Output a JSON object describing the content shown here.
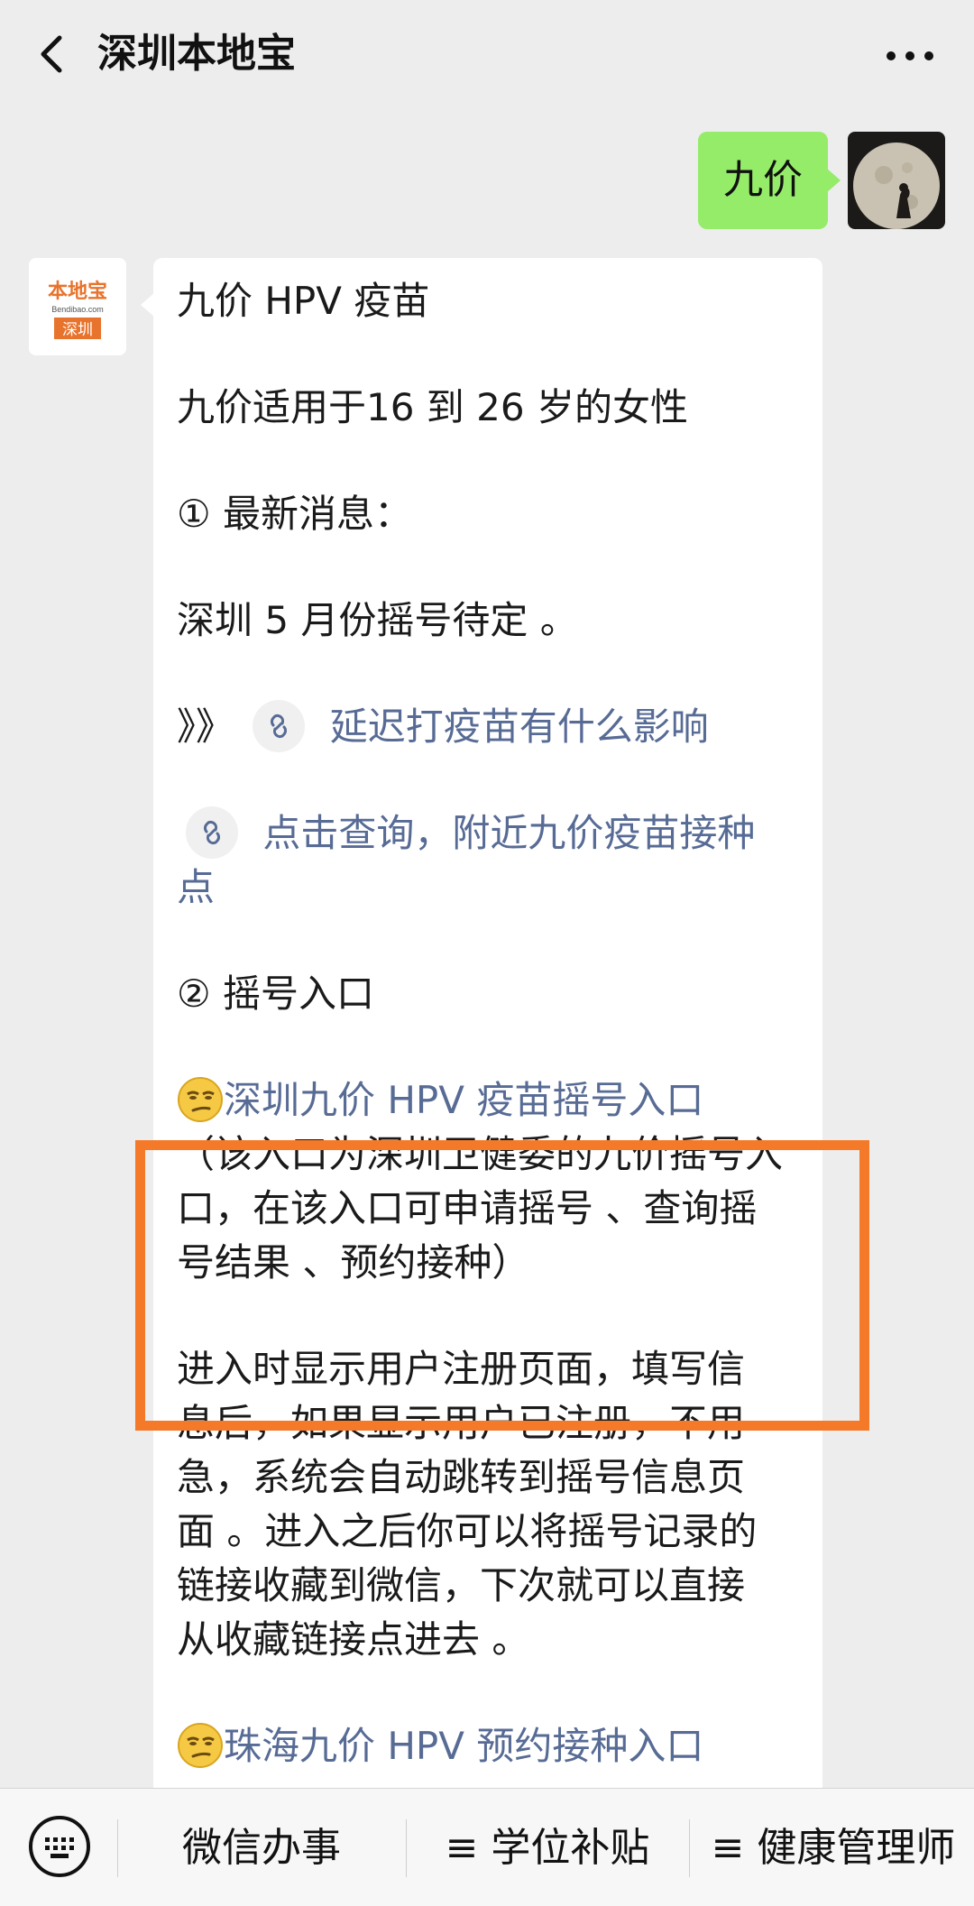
{
  "header": {
    "title": "深圳本地宝"
  },
  "chat": {
    "self_message": "九价",
    "bot_logo": {
      "top": "本地宝",
      "middle": "Bendibao.com",
      "bottom": "深圳"
    },
    "bot_message": {
      "title": "九价 HPV 疫苗",
      "suitable": "九价适用于16 到 26 岁的女性",
      "section1": "① 最新消息：",
      "news": "深圳 5 月份摇号待定 。",
      "arrows": "》》",
      "link_delay": "延迟打疫苗有什么影响",
      "link_query_a": "点击查询，附近九价疫苗接种",
      "link_query_b": "点",
      "section2": "② 摇号入口",
      "link_shenzhen": "深圳九价 HPV 疫苗摇号入口",
      "entry_desc_1": "（该入口为深圳卫健委的九价摇号入",
      "entry_desc_2": "口，在该入口可申请摇号 、查询摇",
      "entry_desc_3": "号结果 、预约接种）",
      "para_1": "进入时显示用户注册页面，填写信",
      "para_2": "息后，如果显示用户已注册，不用",
      "para_3": "急，系统会自动跳转到摇号信息页",
      "para_4": "面 。进入之后你可以将摇号记录的",
      "para_5": "链接收藏到微信，下次就可以直接",
      "para_6": "从收藏链接点进去 。",
      "link_zhuhai": "珠海九价 HPV 预约接种入口"
    }
  },
  "bottom_menu": {
    "items": [
      "微信办事",
      "≡ 学位补贴",
      "≡ 健康管理师"
    ]
  },
  "colors": {
    "background": "#ededed",
    "self_bubble": "#95ec69",
    "link": "#576b95",
    "highlight": "#f47a2a",
    "logo_orange": "#e8732c"
  },
  "icons": [
    "back-icon",
    "more-icon",
    "mini-program-link-icon",
    "smirk-emoji-icon",
    "keyboard-icon"
  ]
}
